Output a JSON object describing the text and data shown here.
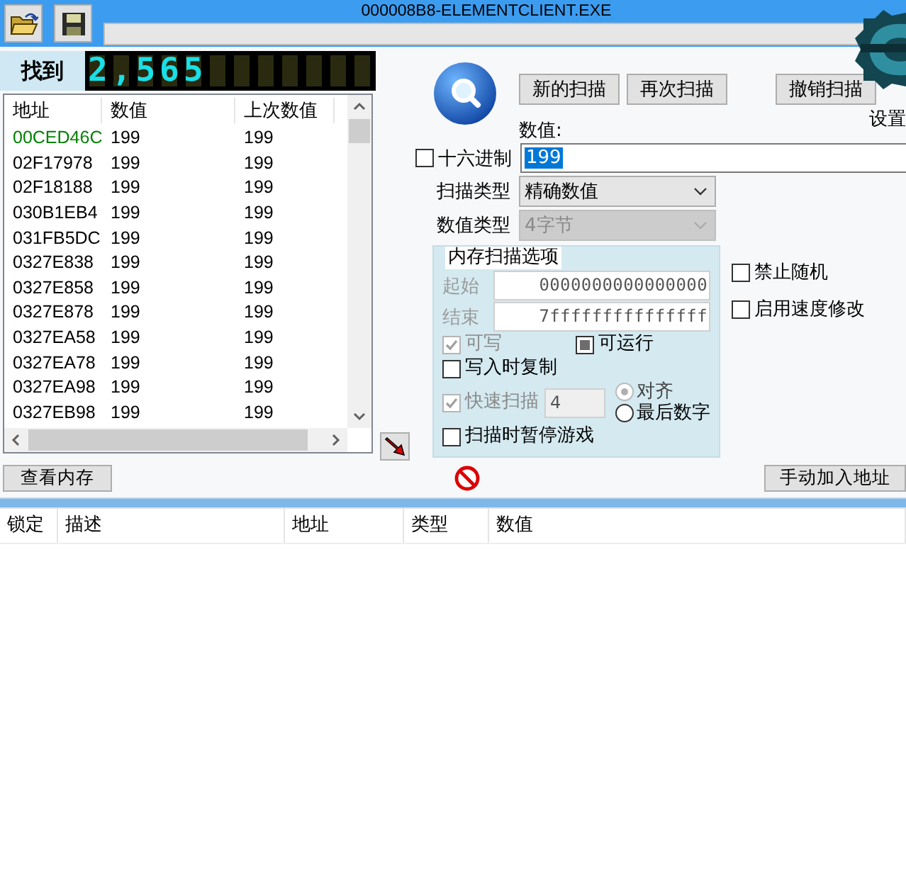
{
  "window": {
    "title": "000008B8-ELEMENTCLIENT.EXE"
  },
  "progress": {
    "level": 0
  },
  "found": {
    "label": "找到",
    "count": "2,565"
  },
  "results": {
    "columns": [
      "地址",
      "数值",
      "上次数值"
    ],
    "rows": [
      {
        "address": "00CED46C",
        "value": "199",
        "previous": "199",
        "static": true
      },
      {
        "address": "02F17978",
        "value": "199",
        "previous": "199",
        "static": false
      },
      {
        "address": "02F18188",
        "value": "199",
        "previous": "199",
        "static": false
      },
      {
        "address": "030B1EB4",
        "value": "199",
        "previous": "199",
        "static": false
      },
      {
        "address": "031FB5DC",
        "value": "199",
        "previous": "199",
        "static": false
      },
      {
        "address": "0327E838",
        "value": "199",
        "previous": "199",
        "static": false
      },
      {
        "address": "0327E858",
        "value": "199",
        "previous": "199",
        "static": false
      },
      {
        "address": "0327E878",
        "value": "199",
        "previous": "199",
        "static": false
      },
      {
        "address": "0327EA58",
        "value": "199",
        "previous": "199",
        "static": false
      },
      {
        "address": "0327EA78",
        "value": "199",
        "previous": "199",
        "static": false
      },
      {
        "address": "0327EA98",
        "value": "199",
        "previous": "199",
        "static": false
      },
      {
        "address": "0327EB98",
        "value": "199",
        "previous": "199",
        "static": false
      }
    ]
  },
  "scan": {
    "buttons": [
      "新的扫描",
      "再次扫描",
      "撤销扫描"
    ],
    "settings_label": "设置",
    "value_label": "数值:",
    "hex": {
      "label": "十六进制",
      "checked": false
    },
    "value": "199",
    "scan_type": {
      "label": "扫描类型",
      "value": "精确数值",
      "disabled": false
    },
    "value_type": {
      "label": "数值类型",
      "value": "4字节",
      "disabled": true
    },
    "memory_options": {
      "title": "内存扫描选项",
      "start_label": "起始",
      "start": "0000000000000000",
      "end_label": "结束",
      "end": "7fffffffffffffff",
      "writable": {
        "label": "可写",
        "checked": true,
        "indeterminate": false,
        "disabled": true
      },
      "executable": {
        "label": "可运行",
        "indeterminate": true,
        "disabled": false
      },
      "copy_on_write": {
        "label": "写入时复制",
        "checked": false,
        "indeterminate": false,
        "disabled": false
      },
      "fast_scan": {
        "label": "快速扫描",
        "checked": true,
        "indeterminate": false,
        "disabled": true,
        "value": "4"
      },
      "alignment": [
        {
          "label": "对齐",
          "selected": true,
          "disabled": true
        },
        {
          "label": "最后数字",
          "selected": false,
          "disabled": false
        }
      ],
      "pause": {
        "label": "扫描时暂停游戏",
        "checked": false,
        "indeterminate": false,
        "disabled": false
      }
    },
    "extra_options": [
      {
        "label": "禁止随机",
        "checked": false
      },
      {
        "label": "启用速度修改",
        "checked": false
      }
    ]
  },
  "memory_view_button": "查看内存",
  "add_address_button": "手动加入地址",
  "address_list": {
    "columns": [
      "锁定",
      "描述",
      "地址",
      "类型",
      "数值"
    ]
  }
}
